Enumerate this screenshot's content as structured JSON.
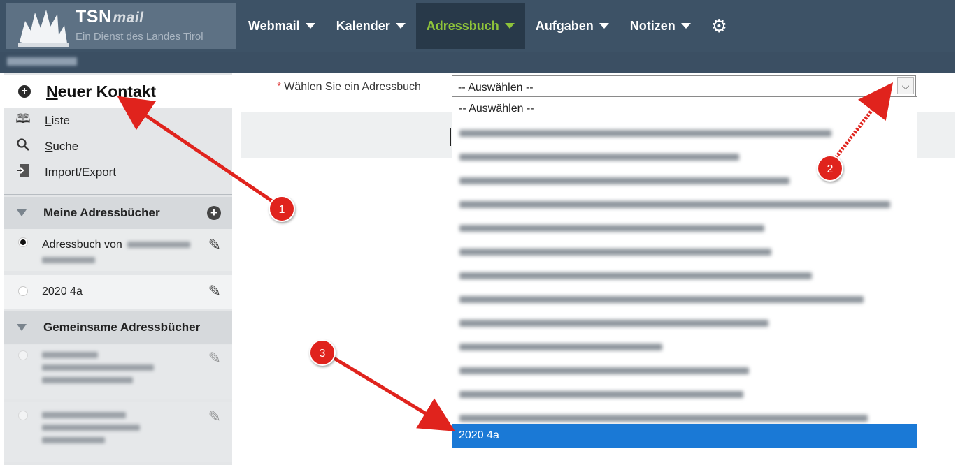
{
  "header": {
    "logo_title": "TSN",
    "logo_title_suffix": "mail",
    "logo_subtitle": "Ein Dienst des Landes Tirol",
    "nav": [
      {
        "label": "Webmail",
        "active": false
      },
      {
        "label": "Kalender",
        "active": false
      },
      {
        "label": "Adressbuch",
        "active": true
      },
      {
        "label": "Aufgaben",
        "active": false
      },
      {
        "label": "Notizen",
        "active": false
      }
    ],
    "settings_icon": "gear-icon"
  },
  "sidebar": {
    "new_contact_label": "Neuer Kontakt",
    "menu": [
      {
        "label": "Liste",
        "icon": "book-icon"
      },
      {
        "label": "Suche",
        "icon": "search-icon"
      },
      {
        "label": "Import/Export",
        "icon": "import-export-icon"
      }
    ],
    "my_section_title": "Meine Adressbücher",
    "my_books": [
      {
        "label": "Adressbuch von",
        "selected": true
      },
      {
        "label": "2020 4a",
        "selected": false
      }
    ],
    "shared_section_title": "Gemeinsame Adressbücher"
  },
  "form": {
    "required_marker": "*",
    "label": "Wählen Sie ein Adressbuch",
    "select_value": "-- Auswählen --",
    "options_visible": [
      "-- Auswählen --",
      "2020 4a"
    ],
    "highlighted_option": "2020 4a"
  },
  "annotations": [
    "1",
    "2",
    "3"
  ],
  "colors": {
    "topbar": "#3d5266",
    "active_nav_text": "#8ec33a",
    "selection_blue": "#1a79d6",
    "annotation_red": "#e0231d"
  }
}
